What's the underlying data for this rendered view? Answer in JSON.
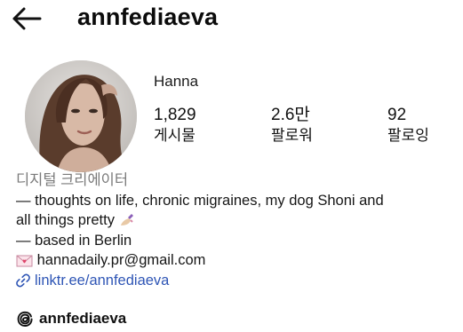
{
  "header": {
    "back_icon": "arrow-left-icon",
    "username": "annfediaeva"
  },
  "profile": {
    "display_name": "Hanna",
    "stats": [
      {
        "value": "1,829",
        "label": "게시물"
      },
      {
        "value": "2.6만",
        "label": "팔로워"
      },
      {
        "value": "92",
        "label": "팔로잉"
      }
    ]
  },
  "bio": {
    "category": "디지털 크리에이터",
    "line1": "— thoughts on life, chronic migraines, my dog Shoni and",
    "line2": "all things pretty",
    "line2_emoji": "nail-polish-icon",
    "line3": "— based in Berlin",
    "email_icon": "love-letter-icon",
    "email": "hannadaily.pr@gmail.com",
    "link_icon": "link-icon",
    "link": "linktr.ee/annfediaeva"
  },
  "threads": {
    "icon": "threads-icon",
    "handle": "annfediaeva"
  },
  "colors": {
    "link": "#2e55b5",
    "category": "#7a7a7a",
    "text": "#111111"
  }
}
